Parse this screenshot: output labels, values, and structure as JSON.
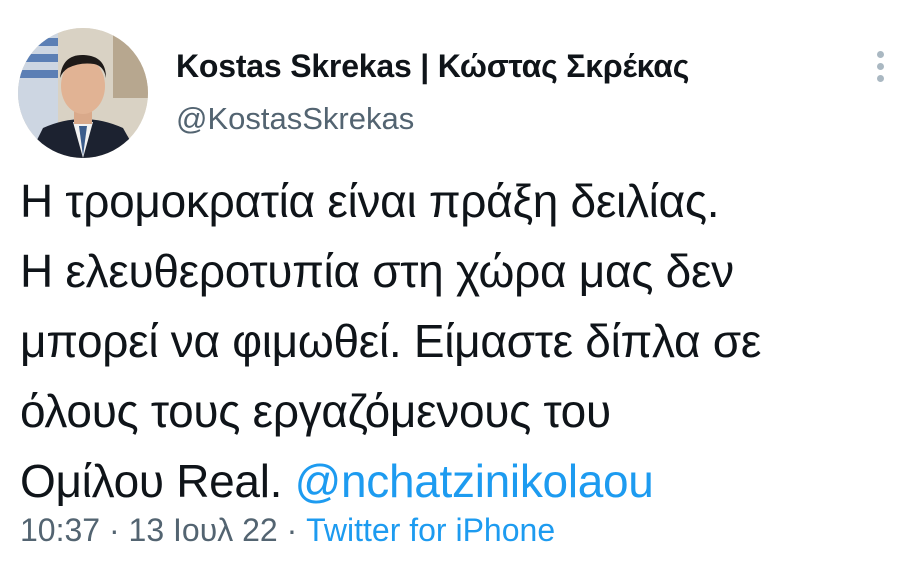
{
  "author": {
    "display_name": "Kostas Skrekas | Κώστας Σκρέκας",
    "handle": "@KostasSkrekas",
    "avatar_icon": "profile-photo"
  },
  "more_icon": "more-vertical-icon",
  "tweet": {
    "lines": [
      "Η τρομοκρατία είναι πράξη δειλίας.",
      "Η ελευθεροτυπία στη χώρα μας δεν",
      "μπορεί να φιμωθεί. Είμαστε δίπλα σε",
      "όλους τους εργαζόμενους του"
    ],
    "last_line_text": "Ομίλου Real. ",
    "mention": "@nchatzinikolaou"
  },
  "meta": {
    "time": "10:37",
    "separator": " · ",
    "date": "13 Ιουλ 22",
    "source": "Twitter for iPhone"
  },
  "colors": {
    "text": "#0f1419",
    "secondary": "#536471",
    "link": "#1d9bf0"
  }
}
